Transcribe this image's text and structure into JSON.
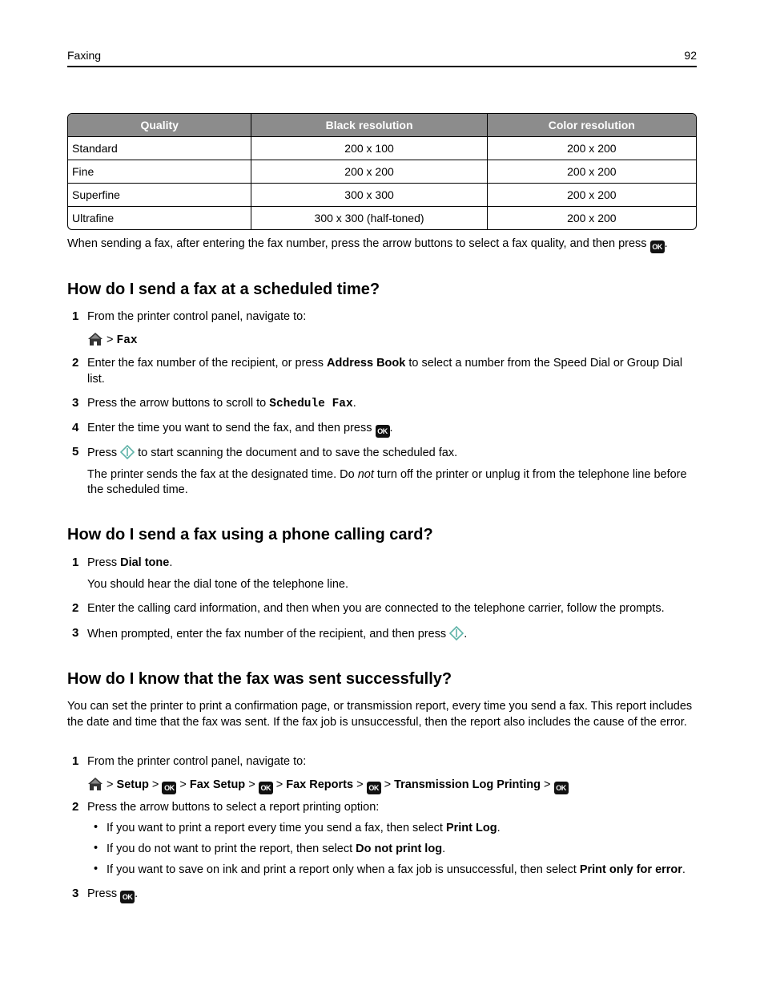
{
  "header": {
    "section": "Faxing",
    "page_number": "92"
  },
  "table": {
    "headers": [
      "Quality",
      "Black resolution",
      "Color resolution"
    ],
    "rows": [
      [
        "Standard",
        "200 x 100",
        "200 x 200"
      ],
      [
        "Fine",
        "200 x 200",
        "200 x 200"
      ],
      [
        "Superfine",
        "300 x 300",
        "200 x 200"
      ],
      [
        "Ultrafine",
        "300 x 300 (half-toned)",
        "200 x 200"
      ]
    ],
    "header_color": "#8c8c8c"
  },
  "quality_note": {
    "text": "When sending a fax, after entering the fax number, press the arrow buttons to select a fax quality, and then press",
    "end": "."
  },
  "sections": {
    "scheduled": {
      "title": "How do I send a fax at a scheduled time?",
      "steps": {
        "s1": {
          "num": "1",
          "text": "From the printer control panel, navigate to:",
          "path_sep": " > ",
          "path_item": "Fax"
        },
        "s2": {
          "num": "2",
          "pre": "Enter the fax number of the recipient, or press ",
          "bold": "Address Book",
          "post": " to select a number from the Speed Dial or Group Dial list."
        },
        "s3": {
          "num": "3",
          "pre": "Press the arrow buttons to scroll to ",
          "mono": "Schedule Fax",
          "post": "."
        },
        "s4": {
          "num": "4",
          "pre": "Enter the time you want to send the fax, and then press",
          "post": "."
        },
        "s5": {
          "num": "5",
          "pre": "Press ",
          "post": " to start scanning the document and to save the scheduled fax.",
          "note_pre": "The printer sends the fax at the designated time. Do ",
          "note_em": "not",
          "note_post": " turn off the printer or unplug it from the telephone line before the scheduled time."
        }
      }
    },
    "calling_card": {
      "title": "How do I send a fax using a phone calling card?",
      "steps": {
        "s1": {
          "num": "1",
          "pre": "Press ",
          "bold": "Dial tone",
          "post": ".",
          "note": "You should hear the dial tone of the telephone line."
        },
        "s2": {
          "num": "2",
          "text": "Enter the calling card information, and then when you are connected to the telephone carrier, follow the prompts."
        },
        "s3": {
          "num": "3",
          "pre": "When prompted, enter the fax number of the recipient, and then press ",
          "post": "."
        }
      }
    },
    "confirm": {
      "title": "How do I know that the fax was sent successfully?",
      "intro": "You can set the printer to print a confirmation page, or transmission report, every time you send a fax. This report includes the date and time that the fax was sent. If the fax job is unsuccessful, then the report also includes the cause of the error.",
      "steps": {
        "s1": {
          "num": "1",
          "text": "From the printer control panel, navigate to:",
          "sep": " > ",
          "path": [
            "Setup",
            "Fax Setup",
            "Fax Reports",
            "Transmission Log Printing"
          ]
        },
        "s2": {
          "num": "2",
          "text": "Press the arrow buttons to select a report printing option:",
          "bullets": [
            {
              "pre": "If you want to print a report every time you send a fax, then select ",
              "bold": "Print Log",
              "post": "."
            },
            {
              "pre": "If you do not want to print the report, then select ",
              "bold": "Do not print log",
              "post": "."
            },
            {
              "pre": "If you want to save on ink and print a report only when a fax job is unsuccessful, then select ",
              "bold": "Print only for error",
              "post": "."
            }
          ]
        },
        "s3": {
          "num": "3",
          "pre": "Press",
          "post": "."
        }
      }
    }
  },
  "icons": {
    "ok_label": "OK",
    "bullet": "•",
    "start_color": "#5fb3a8"
  }
}
